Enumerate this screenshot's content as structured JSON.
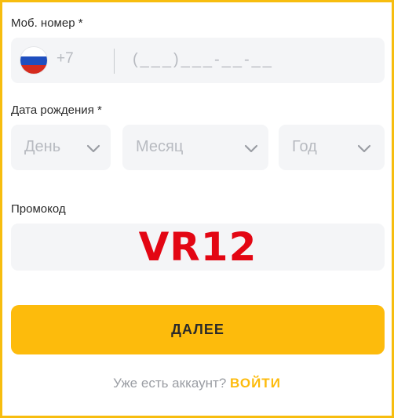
{
  "phone": {
    "label": "Моб. номер *",
    "country_flag": "russia-flag-icon",
    "country_code": "+7",
    "placeholder": "(___)___-__-__"
  },
  "birth": {
    "label": "Дата рождения *",
    "day_placeholder": "День",
    "month_placeholder": "Месяц",
    "year_placeholder": "Год"
  },
  "promo": {
    "label": "Промокод",
    "value": "VR12"
  },
  "submit": {
    "label": "ДАЛЕЕ"
  },
  "footer": {
    "question": "Уже есть аккаунт?",
    "login_link": "ВОЙТИ"
  },
  "colors": {
    "accent": "#fdbb0c",
    "promo_text": "#e30613",
    "field_bg": "#f4f5f7",
    "border": "#f7bd0f"
  }
}
